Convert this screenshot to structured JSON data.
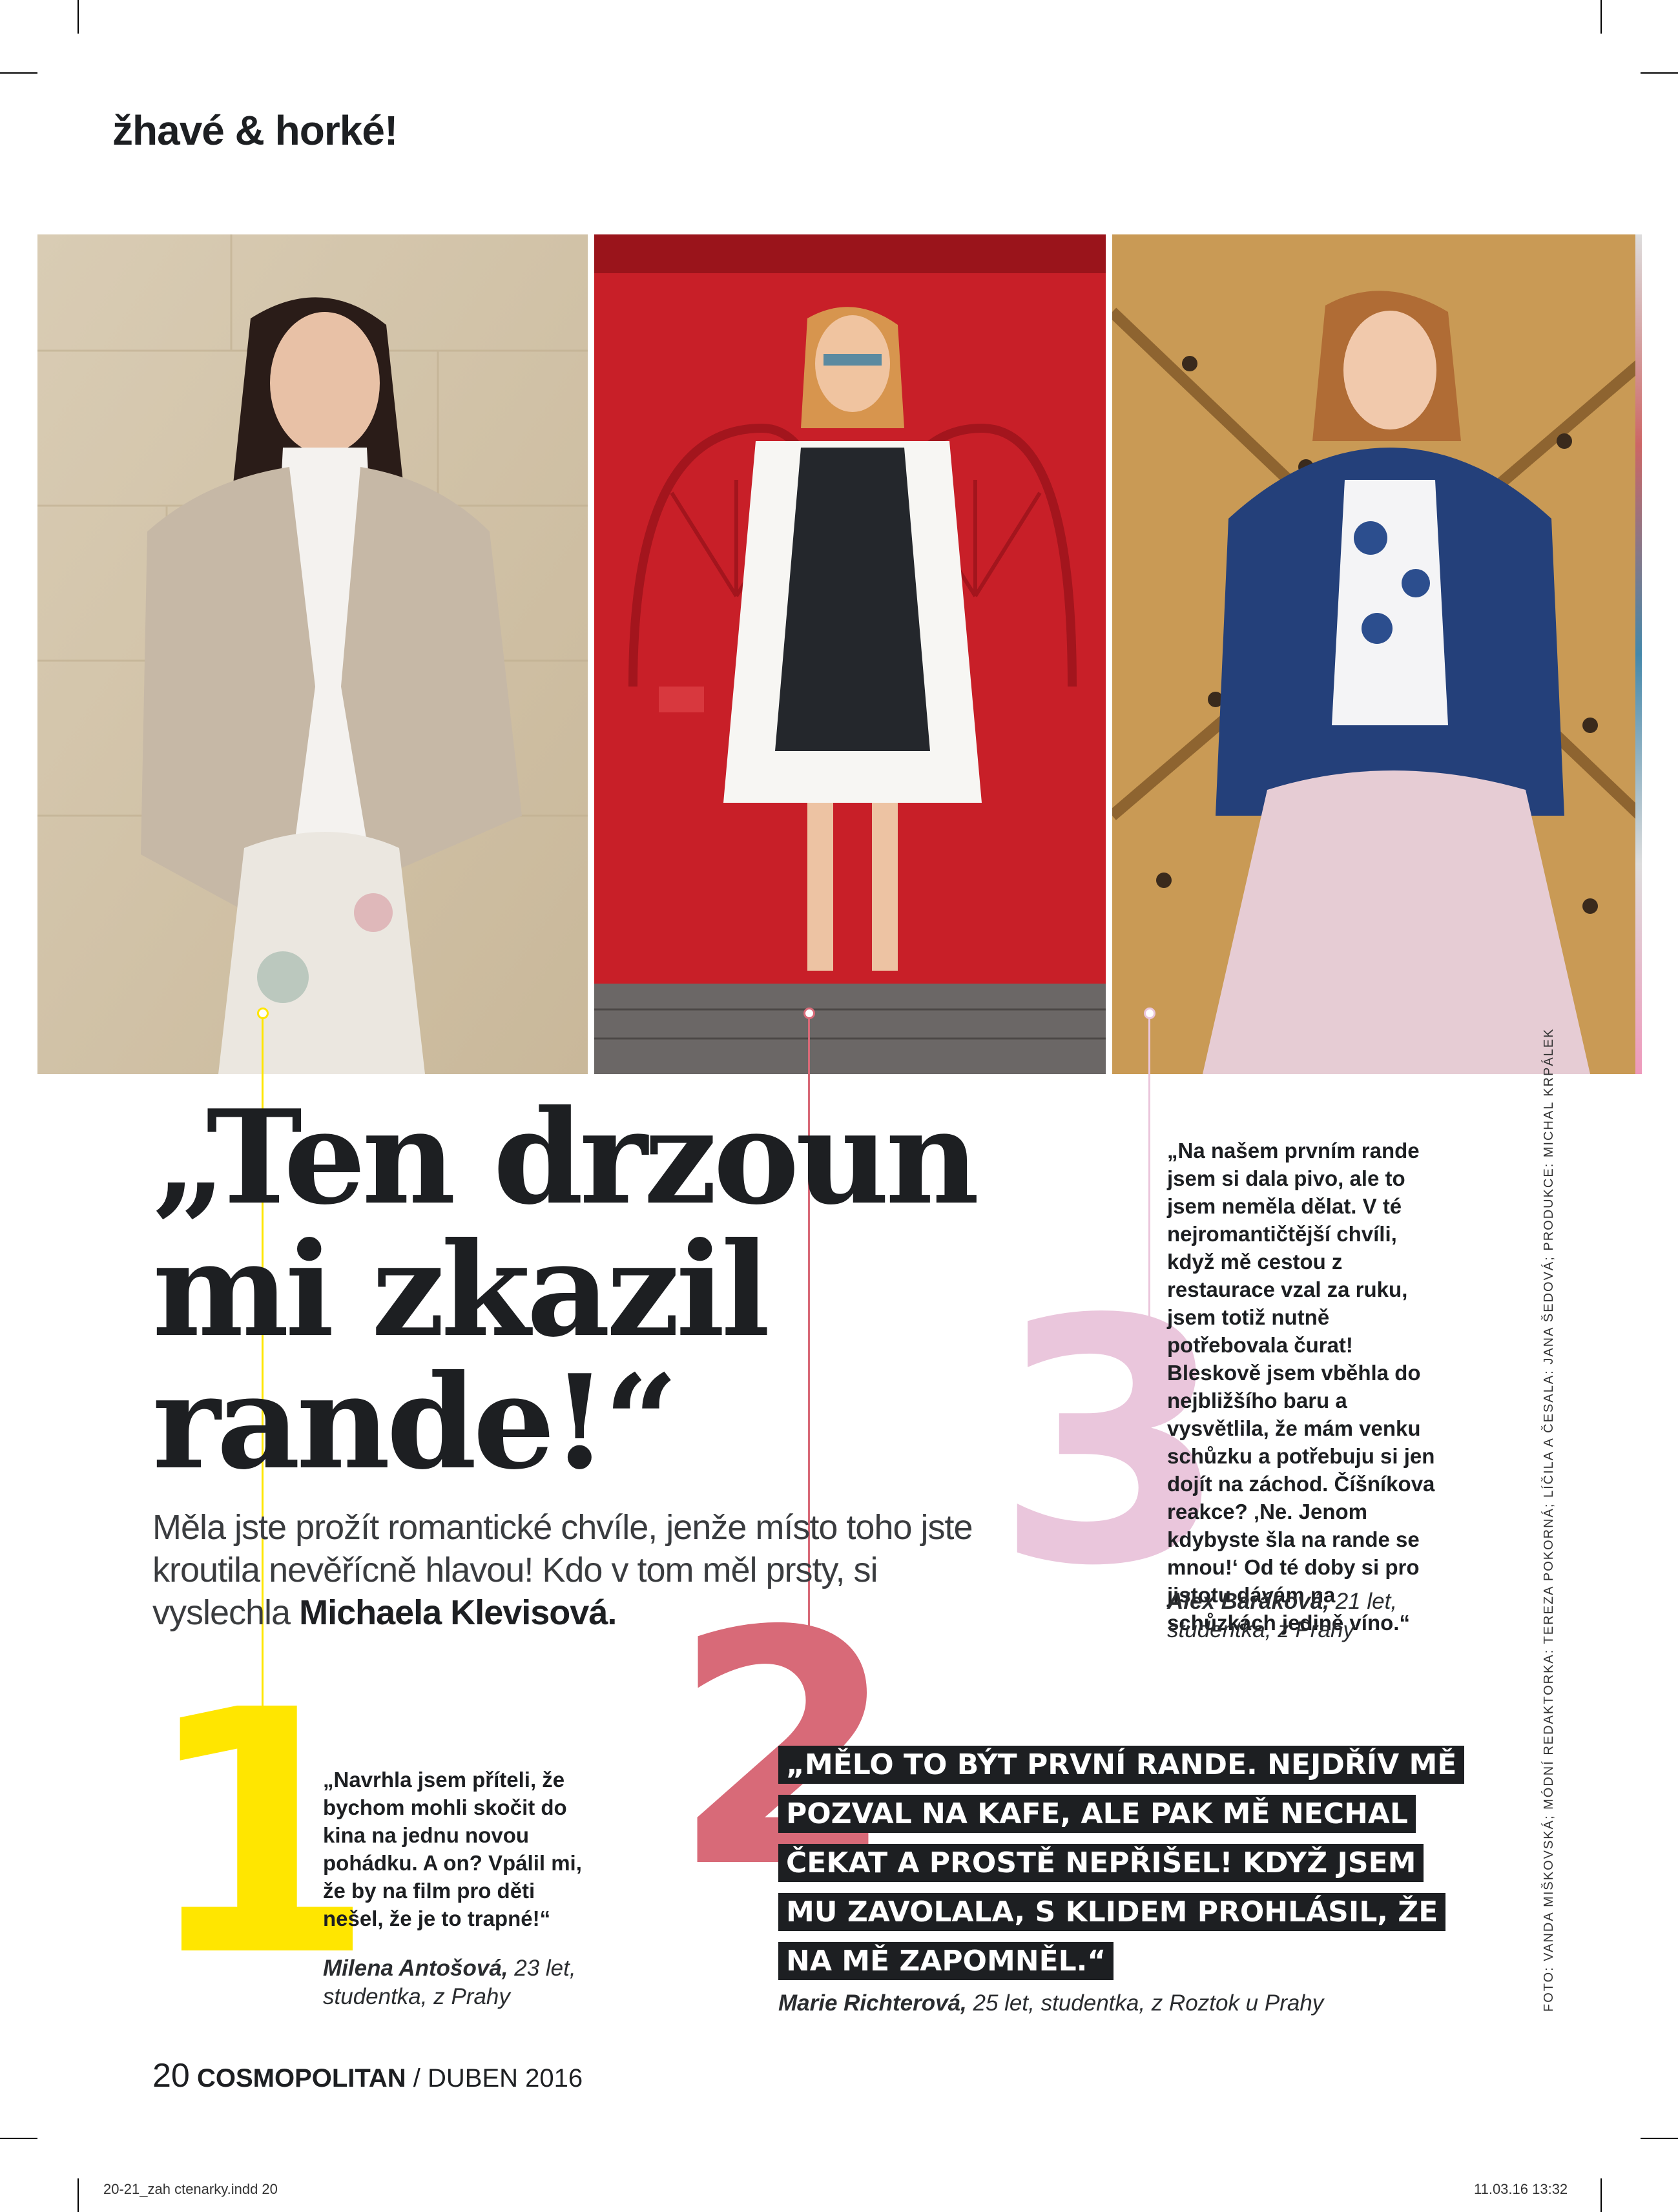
{
  "section_label": "žhavé & horké!",
  "headline": {
    "line1": "„Ten drzoun",
    "line2": "mi zkazil",
    "line3": "rande!“"
  },
  "lead": {
    "text": "Měla jste prožít romantické chvíle, jenže místo toho jste kroutila nevěřícně hlavou! Kdo v tom měl prsty, si vyslechla ",
    "author": "Michaela Klevisová."
  },
  "stories": [
    {
      "number": "1",
      "color": "#ffe600",
      "quote": "„Navrhla jsem příteli, že bychom mohli skočit do kina na jednu novou pohádku. A on? Vpálil mi, že by na film pro děti nešel, že je to trapné!“",
      "name": "Milena Antošová,",
      "details1": " 23 let,",
      "details2": "studentka, z Prahy"
    },
    {
      "number": "2",
      "color": "#d86a78",
      "quote_lines": [
        "„MĚLO TO BÝT PRVNÍ RANDE. NEJDŘÍV MĚ",
        "POZVAL NA KAFE, ALE PAK MĚ NECHAL",
        "ČEKAT A PROSTĚ NEPŘIŠEL! KDYŽ JSEM",
        "MU ZAVOLALA, S KLIDEM PROHLÁSIL, ŽE",
        "NA MĚ ZAPOMNĚL.“"
      ],
      "name": "Marie Richterová,",
      "details": " 25 let, studentka, z Roztok u Prahy"
    },
    {
      "number": "3",
      "color": "#eac6dc",
      "quote": "„Na našem prvním rande jsem si dala pivo, ale to jsem neměla dělat. V té nejromantičtější chvíli, když mě cestou z restaurace vzal za ruku, jsem totiž nutně potřebovala čurat! Bleskově jsem vběhla do nejbližšího baru a vysvětlila, že mám venku schůzku a potřebuju si jen dojít na záchod. Číšníkova reakce? ‚Ne. Jenom kdybyste šla na rande se mnou!‘ Od té doby si pro jistotu dávám na schůzkách jedině víno.“",
      "name": "Alex Baráková,",
      "details1": " 21 let,",
      "details2": "studentka, z Prahy"
    }
  ],
  "credit": "FOTO: VANDA MIŠKOVSKÁ; MÓDNÍ REDAKTORKA: TEREZA POKORNÁ; LÍČILA A ČESALA: JANA ŠEDOVÁ; PRODUKCE: MICHAL KRPÁLEK",
  "footer": {
    "page": "20",
    "brand": "COSMOPOLITAN",
    "sep": " / ",
    "issue": "DUBEN 2016"
  },
  "slug": {
    "file": "20-21_zah ctenarky.indd   20",
    "date": "11.03.16   13:32"
  },
  "colors": {
    "yellow": "#ffe600",
    "coral": "#d86a78",
    "pink": "#eac6dc",
    "dark": "#1d1f22"
  }
}
